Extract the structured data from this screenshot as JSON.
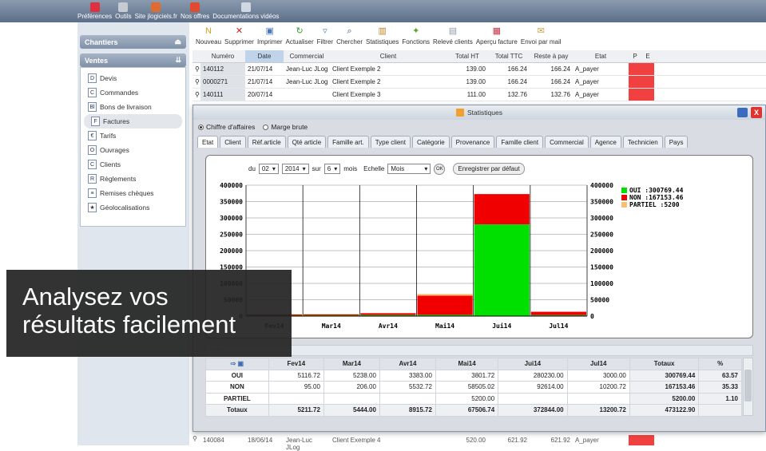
{
  "topnav": [
    {
      "label": "Préférences",
      "icon": "heart-icon",
      "color": "#e03040"
    },
    {
      "label": "Outils",
      "icon": "tools-icon",
      "color": "#c7cbd1"
    },
    {
      "label": "Site jlogiciels.fr",
      "icon": "website-icon",
      "color": "#e06a30"
    },
    {
      "label": "Nos offres",
      "icon": "offers-icon",
      "color": "#e04a30"
    },
    {
      "label": "Documentations vidéos",
      "icon": "video-doc-icon",
      "color": "#d0d8e4"
    }
  ],
  "sidebar": {
    "chantiers": "Chantiers",
    "ventes": "Ventes",
    "items": [
      {
        "label": "Devis",
        "glyph": "D"
      },
      {
        "label": "Commandes",
        "glyph": "C"
      },
      {
        "label": "Bons de livraison",
        "glyph": "Bl"
      },
      {
        "label": "Factures",
        "glyph": "F"
      },
      {
        "label": "Tarifs",
        "glyph": "€"
      },
      {
        "label": "Ouvrages",
        "glyph": "O"
      },
      {
        "label": "Clients",
        "glyph": "C"
      },
      {
        "label": "Règlements",
        "glyph": "R"
      },
      {
        "label": "Remises chèques",
        "glyph": "≡"
      },
      {
        "label": "Géolocalisations",
        "glyph": "★"
      }
    ]
  },
  "toolbar": [
    {
      "label": "Nouveau",
      "glyph": "N",
      "color": "#d4a020"
    },
    {
      "label": "Supprimer",
      "glyph": "✕",
      "color": "#d02020"
    },
    {
      "label": "Imprimer",
      "glyph": "▣",
      "color": "#4a78b8"
    },
    {
      "label": "Actualiser",
      "glyph": "↻",
      "color": "#3a9a3a"
    },
    {
      "label": "Filtrer",
      "glyph": "▿",
      "color": "#5a80b0"
    },
    {
      "label": "Chercher",
      "glyph": "⌕",
      "color": "#3a5a90"
    },
    {
      "label": "Statistiques",
      "glyph": "▥",
      "color": "#c08020"
    },
    {
      "label": "Fonctions",
      "glyph": "✦",
      "color": "#60a030"
    },
    {
      "label": "Relevé clients",
      "glyph": "▤",
      "color": "#909aa8"
    },
    {
      "label": "Aperçu facture",
      "glyph": "▦",
      "color": "#c03040"
    },
    {
      "label": "Envoi par mail",
      "glyph": "✉",
      "color": "#d0a040"
    }
  ],
  "grid": {
    "headers": [
      "Numéro",
      "Date",
      "Commercial",
      "Client",
      "Total HT",
      "Total TTC",
      "Reste à pay",
      "Etat",
      "P",
      "E"
    ],
    "rows": [
      [
        "140112",
        "21/07/14",
        "Jean-Luc JLog",
        "Client Exemple 2",
        "139.00",
        "166.24",
        "166.24",
        "A_payer"
      ],
      [
        "0000271",
        "21/07/14",
        "Jean-Luc JLog",
        "Client Exemple 2",
        "139.00",
        "166.24",
        "166.24",
        "A_payer"
      ],
      [
        "140111",
        "20/07/14",
        "",
        "Client Exemple 3",
        "111.00",
        "132.76",
        "132.76",
        "A_payer"
      ]
    ],
    "bottom_row": [
      "140084",
      "18/06/14",
      "Jean-Luc JLog",
      "Client Exemple 4",
      "520.00",
      "621.92",
      "621.92",
      "A_payer"
    ]
  },
  "modal": {
    "title": "Statistiques",
    "radio_ca": "Chiffre d'affaires",
    "radio_marge": "Marge brute",
    "tabs": [
      "Etat",
      "Client",
      "Réf.article",
      "Qté article",
      "Famille art.",
      "Type client",
      "Catégorie",
      "Provenance",
      "Famille client",
      "Commercial",
      "Agence",
      "Technicien",
      "Pays"
    ],
    "controls": {
      "du": "du",
      "month": "02",
      "year": "2014",
      "sur": "sur",
      "count": "6",
      "mois": "mois",
      "echelle": "Echelle",
      "scale": "Mois",
      "ok": "OK",
      "save": "Enregistrer par défaut"
    }
  },
  "chart_data": {
    "type": "bar",
    "stacked": true,
    "categories": [
      "Fev14",
      "Mar14",
      "Avr14",
      "Mai14",
      "Jui14",
      "Jul14"
    ],
    "series": [
      {
        "name": "OUI",
        "color": "#00e000",
        "values": [
          5116.72,
          5238.0,
          3383.0,
          3801.72,
          280230.0,
          3000.0
        ]
      },
      {
        "name": "NON",
        "color": "#f00000",
        "values": [
          95.0,
          206.0,
          5532.72,
          58505.02,
          92614.0,
          10200.72
        ]
      },
      {
        "name": "PARTIEL",
        "color": "#f8c070",
        "values": [
          0,
          0,
          0,
          5200.0,
          0,
          0
        ]
      }
    ],
    "legend": [
      "OUI :300769.44",
      "NON :167153.46",
      "PARTIEL :5200"
    ],
    "ylim": [
      0,
      400000
    ],
    "yticks": [
      "0",
      "50000",
      "100000",
      "150000",
      "200000",
      "250000",
      "300000",
      "350000",
      "400000"
    ],
    "legend_position": "top-right",
    "grid": true
  },
  "table": {
    "headers": [
      "Fev14",
      "Mar14",
      "Avr14",
      "Mai14",
      "Jui14",
      "Jul14",
      "Totaux",
      "%"
    ],
    "rows": [
      {
        "label": "OUI",
        "values": [
          "5116.72",
          "5238.00",
          "3383.00",
          "3801.72",
          "280230.00",
          "3000.00"
        ],
        "total": "300769.44",
        "pct": "63.57"
      },
      {
        "label": "NON",
        "values": [
          "95.00",
          "206.00",
          "5532.72",
          "58505.02",
          "92614.00",
          "10200.72"
        ],
        "total": "167153.46",
        "pct": "35.33"
      },
      {
        "label": "PARTIEL",
        "values": [
          "",
          "",
          "",
          "5200.00",
          "",
          ""
        ],
        "total": "5200.00",
        "pct": "1.10"
      }
    ],
    "totals": {
      "label": "Totaux",
      "values": [
        "5211.72",
        "5444.00",
        "8915.72",
        "67506.74",
        "372844.00",
        "13200.72"
      ],
      "total": "473122.90"
    }
  },
  "overlay": {
    "line1": "Analysez vos",
    "line2": "résultats facilement"
  }
}
